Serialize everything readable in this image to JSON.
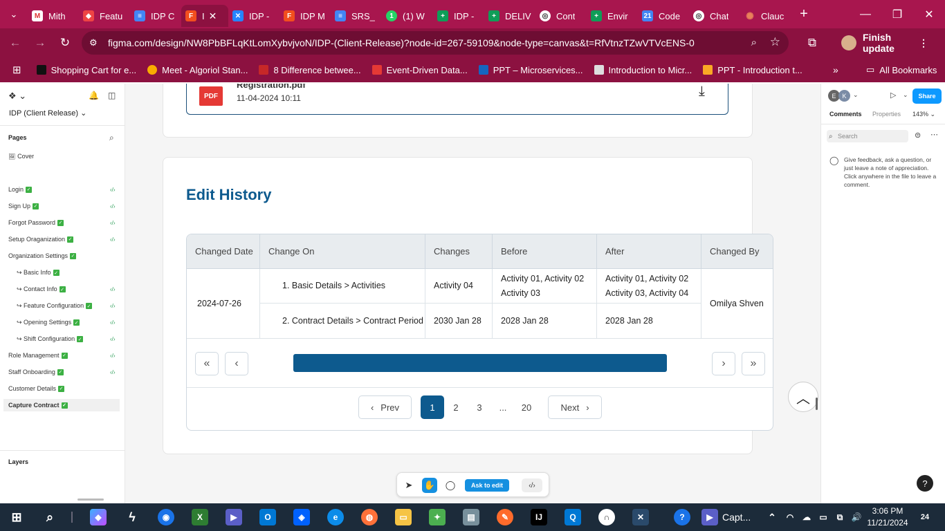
{
  "tabs": [
    "Mith",
    "Featu",
    "IDP C",
    "I",
    "IDP -",
    "IDP M",
    "SRS_",
    "(1) W",
    "IDP -",
    "DELIV",
    "Cont",
    "Envir",
    "Code",
    "Chat",
    "Clauc"
  ],
  "address": {
    "url": "figma.com/design/NW8PbBFLqKtLomXybvjvoN/IDP-(Client-Release)?node-id=267-59109&node-type=canvas&t=RfVtnzTZwVTVcENS-0",
    "finish": "Finish update"
  },
  "bookmarks": [
    "Shopping Cart for e...",
    "Meet - Algoriol Stan...",
    "8 Difference betwee...",
    "Event-Driven Data...",
    "PPT – Microservices...",
    "Introduction to Micr...",
    "PPT - Introduction t..."
  ],
  "all_bookmarks": "All Bookmarks",
  "left": {
    "file": "IDP (Client Release)",
    "pages_label": "Pages",
    "layers_label": "Layers",
    "pages": [
      "Cover",
      "Login",
      "Sign Up",
      "Forgot Password",
      "Setup Oraganization",
      "Organization Settings",
      "↪ Basic Info",
      "↪ Contact Info",
      "↪ Feature Configuration",
      "↪ Opening Settings",
      "↪ Shift Configuration",
      "Role Management",
      "Staff Onboarding",
      "Customer Details",
      "Capture Contract"
    ]
  },
  "download": {
    "badge": "PDF",
    "filename": "Registration.pdf",
    "date": "11-04-2024 10:11"
  },
  "history": {
    "title": "Edit History",
    "headers": [
      "Changed Date",
      "Change On",
      "Changes",
      "Before",
      "After",
      "Changed By"
    ],
    "date": "2024-07-26",
    "changed_by": "Omilya Shven",
    "rows": [
      {
        "change_on": "1.  Basic Details > Activities",
        "changes": "Activity 04",
        "before1": "Activity 01, Activity 02",
        "before2": "Activity 03",
        "after1": "Activity 01, Activity 02",
        "after2": "Activity 03, Activity 04"
      },
      {
        "change_on": "2.  Contract Details > Contract Period",
        "changes": "2030 Jan 28",
        "before1": "2028 Jan 28",
        "after1": "2028 Jan 28"
      }
    ]
  },
  "pagination": {
    "prev": "Prev",
    "next": "Next",
    "pages": [
      "1",
      "2",
      "3",
      "...",
      "20"
    ]
  },
  "toolbar": {
    "ask": "Ask to edit"
  },
  "right": {
    "avatars": [
      "E",
      "K"
    ],
    "share": "Share",
    "tabs": [
      "Comments",
      "Properties"
    ],
    "zoom": "143%",
    "search": "Search",
    "comment_hint": "Give feedback, ask a question, or just leave a note of appreciation. Click anywhere in the file to leave a comment."
  },
  "taskbar": {
    "capt": "Capt...",
    "time": "3:06 PM",
    "date": "11/21/2024",
    "badge": "24"
  }
}
